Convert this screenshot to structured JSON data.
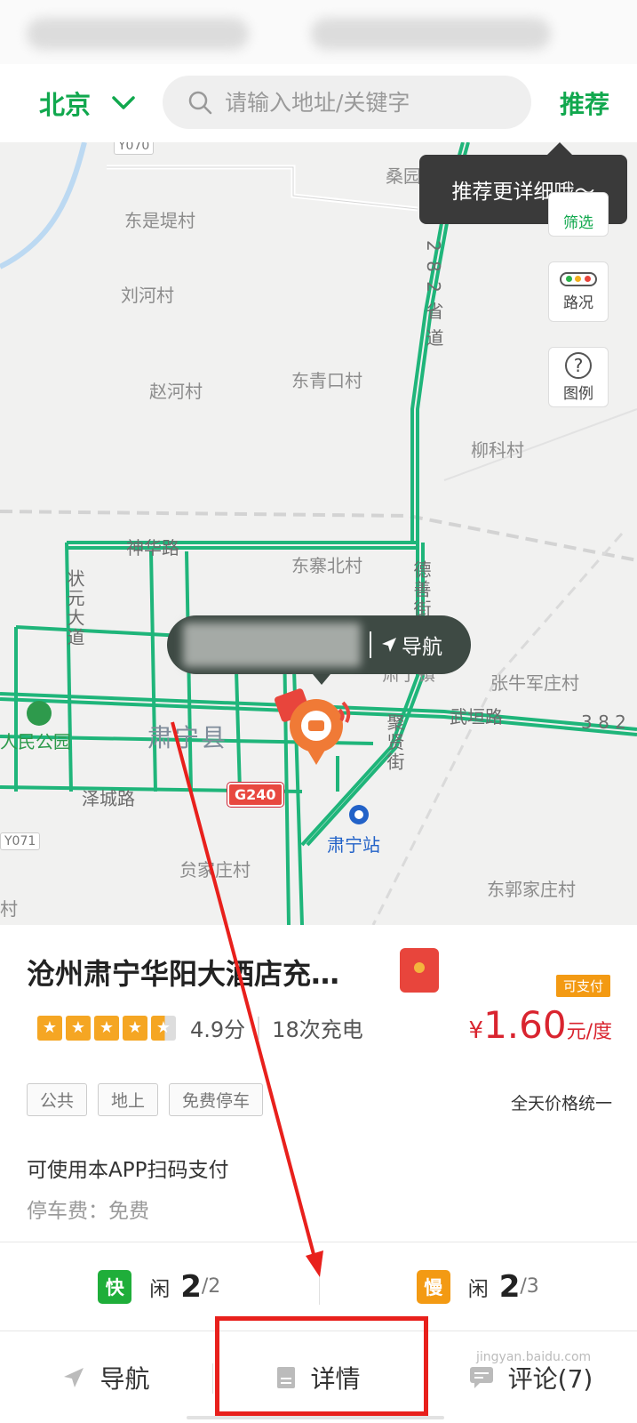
{
  "topbar": {
    "city": "北京",
    "search_placeholder": "请输入地址/关键字",
    "recommend": "推荐"
  },
  "map": {
    "tooltip": "推荐更详细哦～",
    "tools": {
      "filter": "筛选",
      "traffic": "路况",
      "legend": "图例"
    },
    "nav_bubble_label": "导航",
    "labels": {
      "y070": "Y070",
      "sangyuan": "桑园村",
      "dongshiti": "东是堤村",
      "liuhe": "刘河村",
      "zhaohe": "赵河村",
      "dongqingkou": "东青口村",
      "liuke": "柳科村",
      "road282": "2 8 2 省 道",
      "shenhua": "神华路",
      "dongzhaibei": "东寨北村",
      "zhuangyuan": "状元大道",
      "dexian": "德善街",
      "suningzhen": "肃宁镇",
      "zhangniujun": "张牛军庄村",
      "wuyuan": "武垣路",
      "road382": "3 8 2",
      "renmin_park": "人民公园",
      "suning_county": "肃宁县",
      "juxian": "聚贤街",
      "zecheng": "泽城路",
      "g240": "G240",
      "suning_station": "肃宁站",
      "y071": "Y071",
      "yunjiazhuang": "贠家庄村",
      "dongguojiazhuang": "东郭家庄村",
      "cun": "村"
    },
    "colors": {
      "road_green": "#1fb57a",
      "background": "#f1f1f0"
    }
  },
  "station": {
    "title": "沧州肃宁华阳大酒店充…",
    "pay_tag": "可支付",
    "score": "4.9分",
    "charge_count": "18次充电",
    "rating_stars": 4.5,
    "price_currency": "¥",
    "price_value": "1.60",
    "price_unit": "元/度",
    "tags": [
      "公共",
      "地上",
      "免费停车"
    ],
    "flat_price": "全天价格统一",
    "pay_info": "可使用本APP扫码支付",
    "parking_fee": "停车费：免费"
  },
  "ports": {
    "fast": {
      "badge": "快",
      "idle_label": "闲",
      "available": "2",
      "total": "/2",
      "color": "#1fae3a"
    },
    "slow": {
      "badge": "慢",
      "idle_label": "闲",
      "available": "2",
      "total": "/3",
      "color": "#f39a13"
    }
  },
  "actions": {
    "navigate": "导航",
    "details": "详情",
    "reviews": "评论(7)"
  },
  "watermark": "jingyan.baidu.com"
}
